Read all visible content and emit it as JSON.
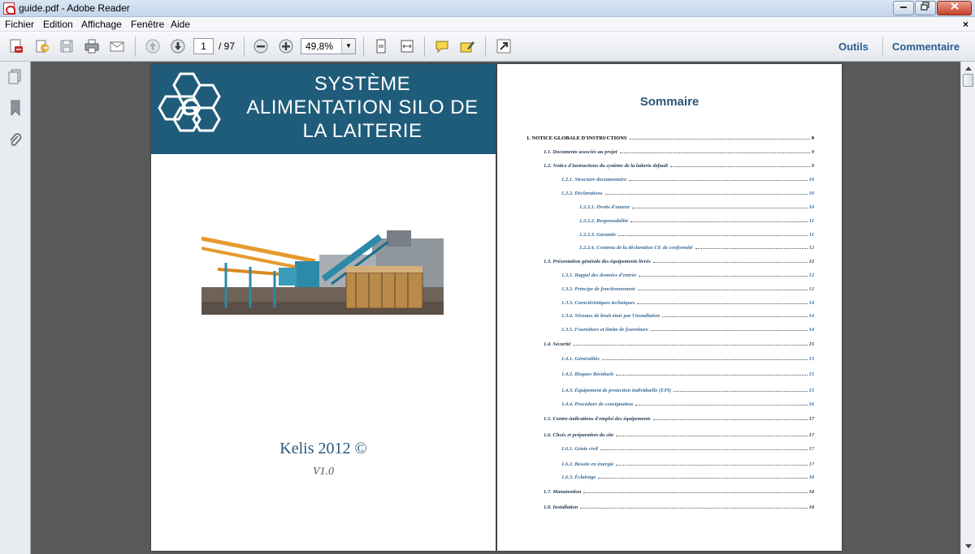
{
  "window": {
    "title": "guide.pdf - Adobe Reader"
  },
  "menubar": {
    "items": [
      "Fichier",
      "Edition",
      "Affichage",
      "Fenêtre",
      "Aide"
    ],
    "close_glyph": "×"
  },
  "toolbar": {
    "icons": [
      "create-pdf-icon",
      "share-icon",
      "save-icon",
      "print-icon",
      "email-icon",
      "prev-page-icon",
      "next-page-icon",
      "zoom-out-icon",
      "zoom-in-icon",
      "fit-page-icon",
      "fit-width-icon",
      "comment-icon",
      "highlight-icon",
      "fullscreen-icon"
    ],
    "page_current": "1",
    "page_total": "/ 97",
    "zoom": "49,8%",
    "zoom_arrow": "▼",
    "tools_label": "Outils",
    "comment_label": "Commentaire"
  },
  "navpanel": {
    "icons": [
      "pages-icon",
      "bookmarks-icon",
      "attachments-icon"
    ]
  },
  "cover": {
    "title_line1": "SYSTÈME",
    "title_line2": "ALIMENTATION SILO DE",
    "title_line3": "LA LAITERIE",
    "logo_letter": "G",
    "company": "Kelis 2012 ©",
    "version": "V1.0"
  },
  "toc": {
    "title": "Sommaire",
    "entries": [
      {
        "text": "1. NOTICE GLOBALE D'INSTRUCTIONS",
        "page": "9"
      },
      {
        "text": "1.1. Documents associés au projet",
        "page": "9"
      },
      {
        "text": "1.2. Notice d'instructions du système de la laiterie default",
        "page": "9"
      },
      {
        "text": "1.2.1. Structure documentaire",
        "page": "10"
      },
      {
        "text": "1.2.2. Déclarations",
        "page": "10"
      },
      {
        "text": "1.2.2.1. Droits d'auteur",
        "page": "10"
      },
      {
        "text": "1.2.2.2. Responsabilité",
        "page": "11"
      },
      {
        "text": "1.2.2.3. Garantie",
        "page": "11"
      },
      {
        "text": "1.2.2.4. Contenu de la déclaration CE de conformité",
        "page": "12"
      },
      {
        "text": "1.3. Présentation générale des équipements livrés",
        "page": "12"
      },
      {
        "text": "1.3.1. Rappel des données d'entrée",
        "page": "12"
      },
      {
        "text": "1.3.2. Principe de fonctionnement",
        "page": "12"
      },
      {
        "text": "1.3.3. Caractéristiques techniques",
        "page": "14"
      },
      {
        "text": "1.3.4. Niveaux de bruit émis par l'installation",
        "page": "14"
      },
      {
        "text": "1.3.5. Fourniture et limite de fourniture",
        "page": "14"
      },
      {
        "text": "1.4. Sécurité",
        "page": "15"
      },
      {
        "text": "1.4.1. Généralités",
        "page": "15"
      },
      {
        "text": "1.4.2. Risques Résiduels",
        "page": "15"
      },
      {
        "text": "1.4.3. Équipement de protection individuelle (EPI)",
        "page": "15"
      },
      {
        "text": "1.4.4. Procédure de consignation",
        "page": "16"
      },
      {
        "text": "1.5. Contre-indications d'emploi des équipements",
        "page": "17"
      },
      {
        "text": "1.6. Choix et préparation du site",
        "page": "17"
      },
      {
        "text": "1.6.1. Génie civil",
        "page": "17"
      },
      {
        "text": "1.6.2. Besoin en énergie",
        "page": "17"
      },
      {
        "text": "1.6.3. Éclairage",
        "page": "18"
      },
      {
        "text": "1.7. Manutention",
        "page": "18"
      },
      {
        "text": "1.8. Installation",
        "page": "18"
      }
    ]
  },
  "colors": {
    "accent": "#1f5c7a",
    "link": "#2a5d8f",
    "doc_bg": "#595959"
  }
}
